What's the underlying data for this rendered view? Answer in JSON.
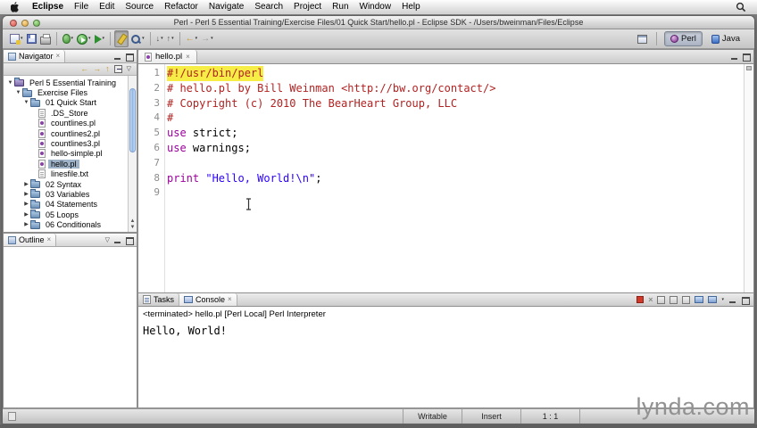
{
  "menubar": {
    "items": [
      {
        "label": "Eclipse",
        "bold": true
      },
      {
        "label": "File"
      },
      {
        "label": "Edit"
      },
      {
        "label": "Source"
      },
      {
        "label": "Refactor"
      },
      {
        "label": "Navigate"
      },
      {
        "label": "Search"
      },
      {
        "label": "Project"
      },
      {
        "label": "Run"
      },
      {
        "label": "Window"
      },
      {
        "label": "Help"
      }
    ]
  },
  "window": {
    "title": "Perl - Perl 5 Essential Training/Exercise Files/01 Quick Start/hello.pl - Eclipse SDK - /Users/bweinman/Files/Eclipse"
  },
  "toolbar": {
    "perspectives": [
      {
        "label": "Perl",
        "active": true
      },
      {
        "label": "Java",
        "active": false
      }
    ]
  },
  "navigator": {
    "title": "Navigator",
    "tree": [
      {
        "label": "Perl 5 Essential Training",
        "depth": 0,
        "icon": "project",
        "exp": "open"
      },
      {
        "label": "Exercise Files",
        "depth": 1,
        "icon": "folder",
        "exp": "open"
      },
      {
        "label": "01 Quick Start",
        "depth": 2,
        "icon": "folder",
        "exp": "open"
      },
      {
        "label": ".DS_Store",
        "depth": 3,
        "icon": "file"
      },
      {
        "label": "countlines.pl",
        "depth": 3,
        "icon": "perl"
      },
      {
        "label": "countlines2.pl",
        "depth": 3,
        "icon": "perl"
      },
      {
        "label": "countlines3.pl",
        "depth": 3,
        "icon": "perl"
      },
      {
        "label": "hello-simple.pl",
        "depth": 3,
        "icon": "perl"
      },
      {
        "label": "hello.pl",
        "depth": 3,
        "icon": "perl",
        "selected": true
      },
      {
        "label": "linesfile.txt",
        "depth": 3,
        "icon": "file"
      },
      {
        "label": "02 Syntax",
        "depth": 2,
        "icon": "folder",
        "exp": "closed"
      },
      {
        "label": "03 Variables",
        "depth": 2,
        "icon": "folder",
        "exp": "closed"
      },
      {
        "label": "04 Statements",
        "depth": 2,
        "icon": "folder",
        "exp": "closed"
      },
      {
        "label": "05 Loops",
        "depth": 2,
        "icon": "folder",
        "exp": "closed"
      },
      {
        "label": "06 Conditionals",
        "depth": 2,
        "icon": "folder",
        "exp": "closed"
      }
    ]
  },
  "outline": {
    "title": "Outline"
  },
  "editor": {
    "tab": "hello.pl",
    "lines": [
      {
        "hl": true,
        "segs": [
          {
            "c": "comment",
            "t": "#!/usr/bin/perl"
          }
        ]
      },
      {
        "segs": [
          {
            "c": "comment",
            "t": "# hello.pl by Bill Weinman <http://bw.org/contact/>"
          }
        ]
      },
      {
        "segs": [
          {
            "c": "comment",
            "t": "# Copyright (c) 2010 The BearHeart Group, LLC"
          }
        ]
      },
      {
        "segs": [
          {
            "c": "comment",
            "t": "#"
          }
        ]
      },
      {
        "segs": [
          {
            "c": "keyword",
            "t": "use"
          },
          {
            "c": "plain",
            "t": " strict;"
          }
        ]
      },
      {
        "segs": [
          {
            "c": "keyword",
            "t": "use"
          },
          {
            "c": "plain",
            "t": " warnings;"
          }
        ]
      },
      {
        "segs": []
      },
      {
        "segs": [
          {
            "c": "keyword",
            "t": "print"
          },
          {
            "c": "plain",
            "t": " "
          },
          {
            "c": "string",
            "t": "\"Hello, World!\\n\""
          },
          {
            "c": "plain",
            "t": ";"
          }
        ]
      },
      {
        "segs": []
      }
    ]
  },
  "console": {
    "tabs": [
      {
        "label": "Tasks",
        "active": false
      },
      {
        "label": "Console",
        "active": true
      }
    ],
    "status": "<terminated> hello.pl [Perl Local] Perl Interpreter",
    "output": "Hello, World!"
  },
  "statusbar": {
    "writable": "Writable",
    "insert": "Insert",
    "position": "1 : 1"
  },
  "watermark": "lynda.com",
  "icons": {
    "close_x": "×",
    "dropdown_chevron": "▾",
    "back_arrow": "←",
    "forward_arrow": "→",
    "up_arrow": "↑",
    "prev_annotation": "↑",
    "next_annotation": "↓",
    "view_menu": "▽",
    "scroll_up": "▲",
    "scroll_down": "▼"
  },
  "colors": {
    "comment": "#b22222",
    "keyword": "#990099",
    "string": "#2a00ff",
    "line_highlight": "#f6ee46",
    "tree_selection": "#9fb3c8"
  }
}
